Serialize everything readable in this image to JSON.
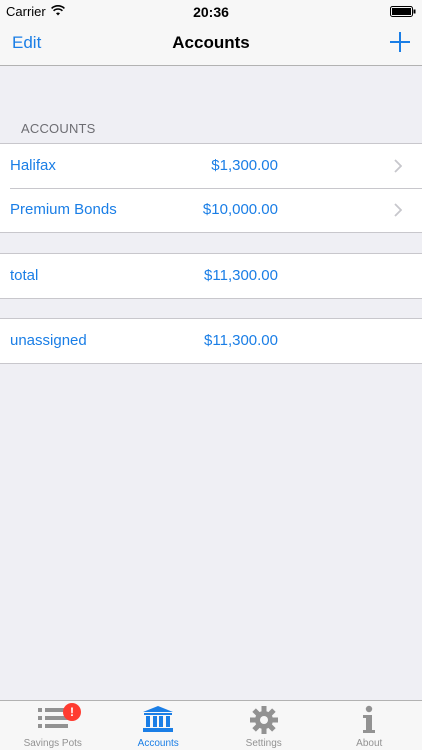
{
  "status_bar": {
    "carrier": "Carrier",
    "time": "20:36"
  },
  "nav": {
    "edit_label": "Edit",
    "title": "Accounts"
  },
  "accounts_section": {
    "header": "ACCOUNTS",
    "items": [
      {
        "name": "Halifax",
        "amount": "$1,300.00"
      },
      {
        "name": "Premium Bonds",
        "amount": "$10,000.00"
      }
    ]
  },
  "total": {
    "name": "total",
    "amount": "$11,300.00"
  },
  "unassigned": {
    "name": "unassigned",
    "amount": "$11,300.00"
  },
  "tab_bar": {
    "tabs": [
      {
        "label": "Savings Pots",
        "icon": "list-icon",
        "badge": "!"
      },
      {
        "label": "Accounts",
        "icon": "bank-icon"
      },
      {
        "label": "Settings",
        "icon": "gear-icon"
      },
      {
        "label": "About",
        "icon": "info-icon"
      }
    ],
    "active_color": "#1a7ee6",
    "inactive_color": "#929292"
  },
  "colors": {
    "accent": "#1a7ee6",
    "badge": "#ff3b30",
    "background": "#efeff4"
  }
}
